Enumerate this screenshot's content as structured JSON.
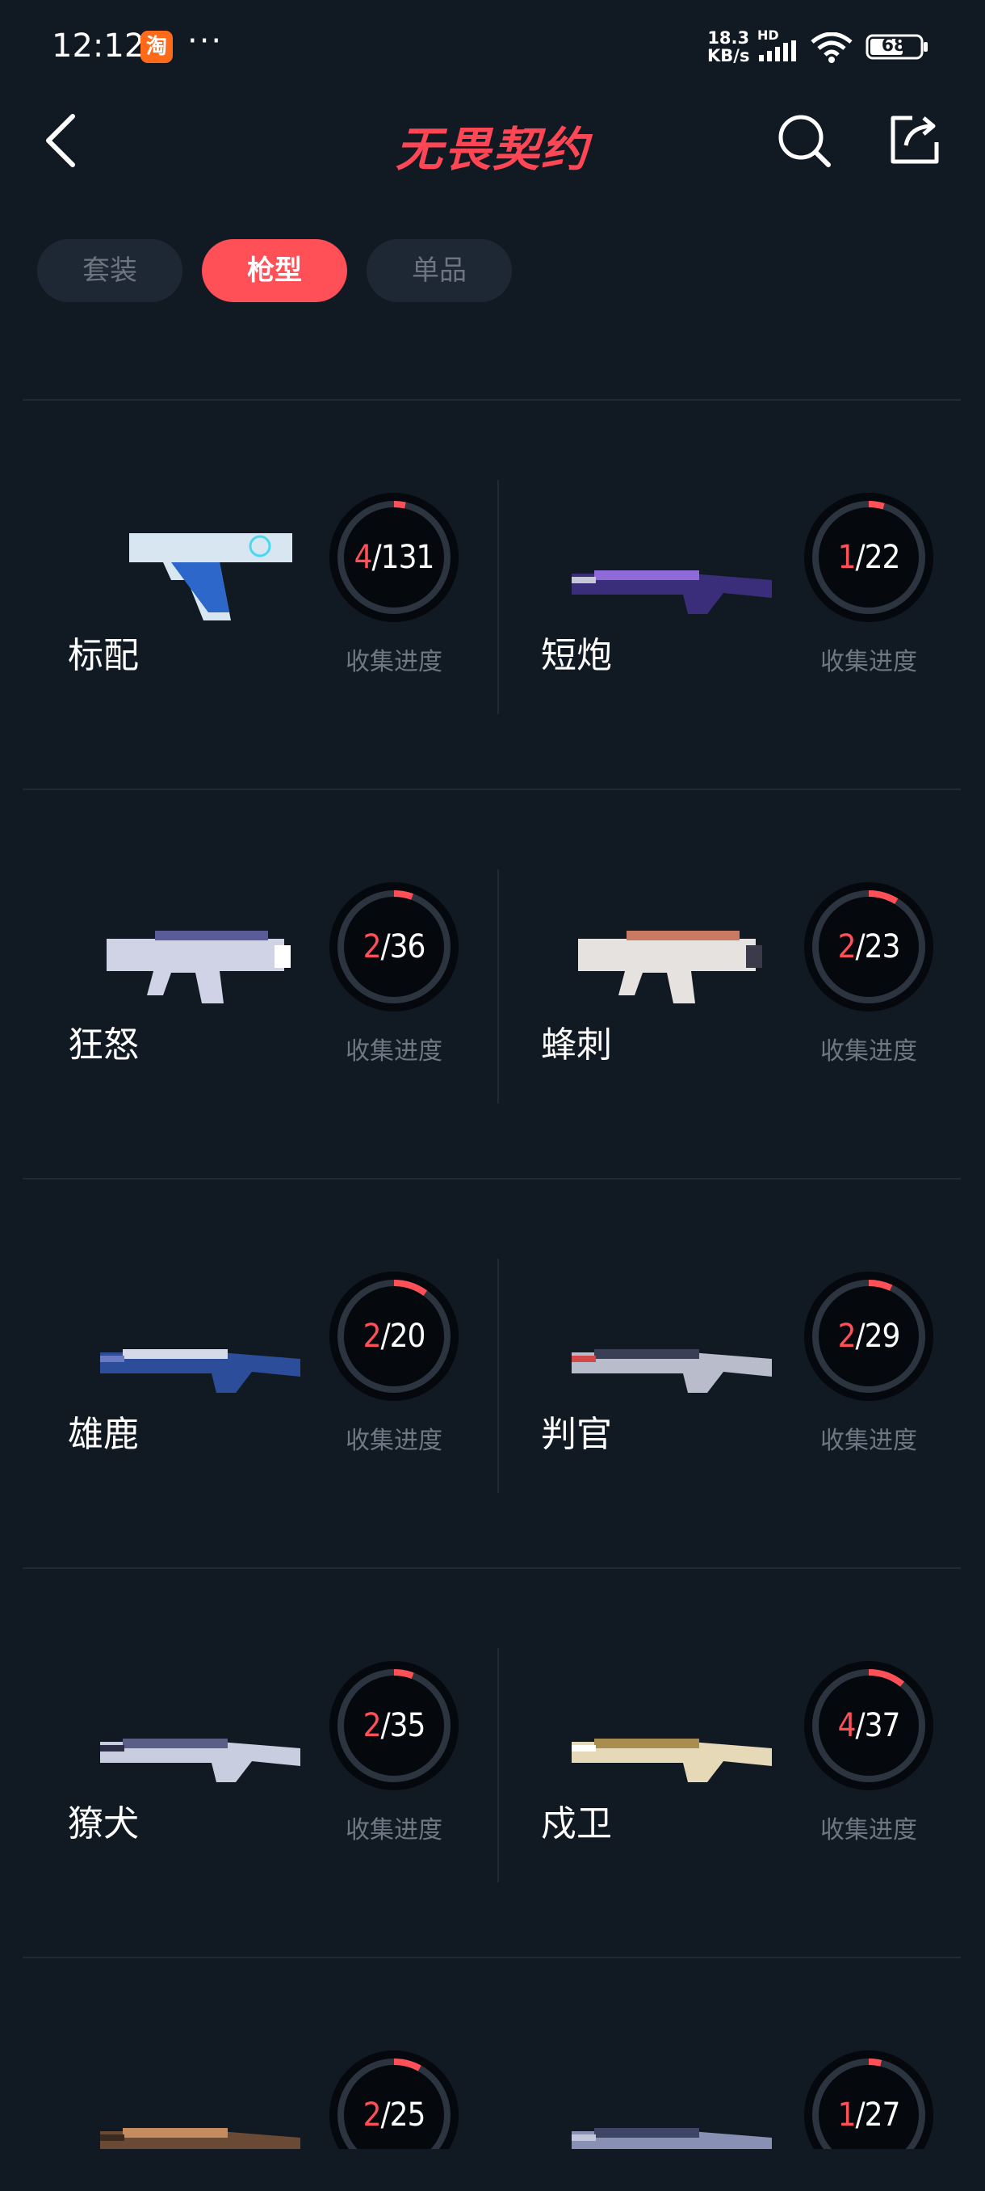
{
  "status_bar": {
    "time": "12:12",
    "more": "···",
    "net_speed_value": "18.3",
    "net_speed_unit": "KB/s",
    "hd": "HD",
    "battery": "68"
  },
  "header": {
    "title": "无畏契约",
    "back_icon": "chevron-left-icon",
    "search_icon": "search-icon",
    "share_icon": "share-icon"
  },
  "tabs": [
    {
      "label": "套装",
      "active": false
    },
    {
      "label": "枪型",
      "active": true
    },
    {
      "label": "单品",
      "active": false
    }
  ],
  "colors": {
    "background": "#111923",
    "accent": "#ff4f57",
    "ring_track": "#2c3440",
    "label": "#6f7782"
  },
  "progress_label": "收集进度",
  "weapons": [
    {
      "name": "标配",
      "collected": "4",
      "total": "131"
    },
    {
      "name": "短炮",
      "collected": "1",
      "total": "22"
    },
    {
      "name": "狂怒",
      "collected": "2",
      "total": "36"
    },
    {
      "name": "蜂刺",
      "collected": "2",
      "total": "23"
    },
    {
      "name": "雄鹿",
      "collected": "2",
      "total": "20"
    },
    {
      "name": "判官",
      "collected": "2",
      "total": "29"
    },
    {
      "name": "獠犬",
      "collected": "2",
      "total": "35"
    },
    {
      "name": "戍卫",
      "collected": "4",
      "total": "37"
    },
    {
      "name": "",
      "collected": "2",
      "total": "25"
    },
    {
      "name": "",
      "collected": "1",
      "total": "27"
    }
  ]
}
